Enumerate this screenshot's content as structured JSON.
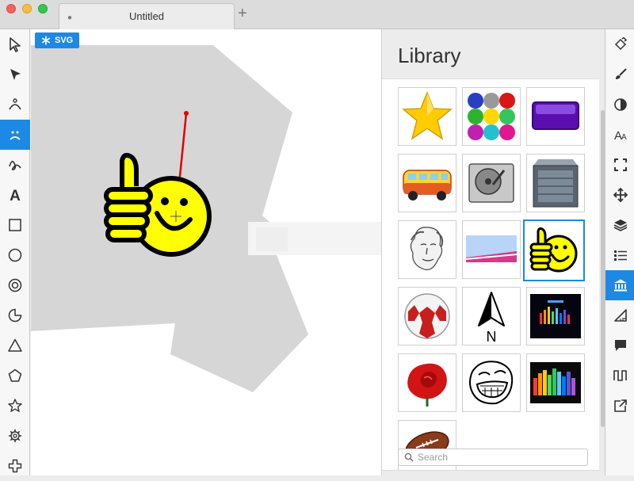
{
  "window": {
    "tab_title": "Untitled",
    "tab_modified_dot": "●",
    "new_tab_label": "+"
  },
  "canvas": {
    "format_badge": "SVG",
    "format_badge_icon": "snowflake-icon"
  },
  "left_toolbar": {
    "tools": [
      {
        "name": "select-tool",
        "icon": "arrow-pointer-icon"
      },
      {
        "name": "node-tool",
        "icon": "node-arrow-icon"
      },
      {
        "name": "bend-tool",
        "icon": "bend-curve-icon"
      },
      {
        "name": "shape-tool",
        "icon": "face-tool-icon",
        "active": true
      },
      {
        "name": "freehand-tool",
        "icon": "scribble-icon"
      },
      {
        "name": "text-tool",
        "icon": "letter-a-icon"
      },
      {
        "name": "rectangle-tool",
        "icon": "square-icon"
      },
      {
        "name": "ellipse-tool",
        "icon": "circle-icon"
      },
      {
        "name": "ring-tool",
        "icon": "ring-icon"
      },
      {
        "name": "pie-tool",
        "icon": "pie-icon"
      },
      {
        "name": "triangle-tool",
        "icon": "triangle-icon"
      },
      {
        "name": "pentagon-tool",
        "icon": "pentagon-icon"
      },
      {
        "name": "star-tool",
        "icon": "star-icon"
      },
      {
        "name": "gear-tool",
        "icon": "gear-icon"
      },
      {
        "name": "cross-tool",
        "icon": "cross-icon"
      }
    ]
  },
  "library": {
    "title": "Library",
    "items": [
      {
        "name": "star",
        "icon": "gold-star-image"
      },
      {
        "name": "glass-buttons",
        "icon": "glass-balls-image"
      },
      {
        "name": "purple-button",
        "icon": "purple-button-image"
      },
      {
        "name": "hippie-van",
        "icon": "van-image"
      },
      {
        "name": "hard-drive",
        "icon": "hard-drive-image"
      },
      {
        "name": "metal-box",
        "icon": "metal-box-image"
      },
      {
        "name": "portrait-sketch",
        "icon": "portrait-image"
      },
      {
        "name": "gradient-banner",
        "icon": "banner-image"
      },
      {
        "name": "thumbs-up-smiley",
        "icon": "thumbs-up-smiley-image",
        "selected": true
      },
      {
        "name": "soccer-ball",
        "icon": "soccer-ball-image"
      },
      {
        "name": "north-arrow",
        "icon": "north-arrow-image",
        "label": "N"
      },
      {
        "name": "equalizer-dark",
        "icon": "equalizer-image"
      },
      {
        "name": "red-rose",
        "icon": "rose-image"
      },
      {
        "name": "troll-face",
        "icon": "troll-face-image"
      },
      {
        "name": "equalizer-bars",
        "icon": "equalizer-bars-image"
      },
      {
        "name": "football",
        "icon": "football-image"
      }
    ],
    "search_placeholder": "Search"
  },
  "right_toolbar": {
    "tools": [
      {
        "name": "fill-tool",
        "icon": "paint-bucket-icon"
      },
      {
        "name": "stroke-tool",
        "icon": "brush-icon"
      },
      {
        "name": "opacity-tool",
        "icon": "contrast-icon"
      },
      {
        "name": "font-tool",
        "icon": "font-size-icon"
      },
      {
        "name": "frame-tool",
        "icon": "frame-corners-icon"
      },
      {
        "name": "arrange-tool",
        "icon": "move-arrows-icon"
      },
      {
        "name": "layers-tool",
        "icon": "layers-icon"
      },
      {
        "name": "list-tool",
        "icon": "list-icon"
      },
      {
        "name": "library-tool",
        "icon": "library-icon",
        "active": true
      },
      {
        "name": "measure-tool",
        "icon": "ruler-triangle-icon"
      },
      {
        "name": "comment-tool",
        "icon": "speech-bubble-icon"
      },
      {
        "name": "waveform-tool",
        "icon": "square-wave-icon"
      },
      {
        "name": "export-tool",
        "icon": "export-icon"
      }
    ]
  },
  "colors": {
    "accent": "#1e88e5",
    "smiley_yellow": "#ffff00",
    "handle_red": "#e00000"
  }
}
